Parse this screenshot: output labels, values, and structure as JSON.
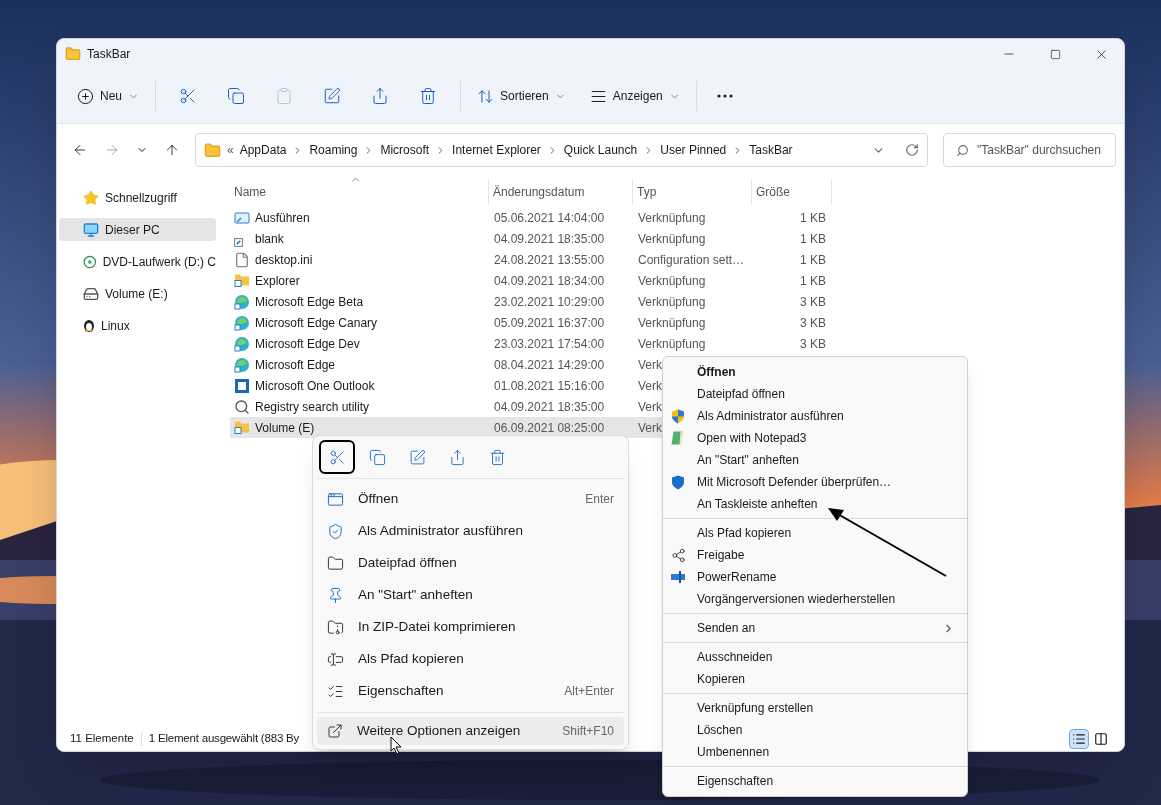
{
  "window": {
    "title": "TaskBar"
  },
  "toolbar": {
    "new_label": "Neu",
    "sort_label": "Sortieren",
    "view_label": "Anzeigen",
    "actions": [
      {
        "kind": "cut",
        "disabled": false
      },
      {
        "kind": "copy",
        "disabled": false
      },
      {
        "kind": "paste",
        "disabled": true
      },
      {
        "kind": "rename",
        "disabled": false
      },
      {
        "kind": "share",
        "disabled": false
      },
      {
        "kind": "delete",
        "disabled": false
      }
    ]
  },
  "address": {
    "prefix": "«",
    "crumbs": [
      "AppData",
      "Roaming",
      "Microsoft",
      "Internet Explorer",
      "Quick Launch",
      "User Pinned",
      "TaskBar"
    ],
    "search_placeholder": "\"TaskBar\" durchsuchen"
  },
  "sidebar": {
    "items": [
      {
        "label": "Schnellzugriff",
        "kind": "star",
        "selected": false
      },
      {
        "label": "Dieser PC",
        "kind": "pc",
        "selected": true
      },
      {
        "label": "DVD-Laufwerk (D:) C",
        "kind": "dvd",
        "selected": false
      },
      {
        "label": "Volume (E:)",
        "kind": "drive",
        "selected": false
      },
      {
        "label": "Linux",
        "kind": "linux",
        "selected": false
      }
    ]
  },
  "table": {
    "columns": [
      "Name",
      "Änderungsdatum",
      "Typ",
      "Größe"
    ],
    "rows": [
      {
        "name": "Ausführen",
        "date": "05.06.2021 14:04:00",
        "type": "Verknüpfung",
        "size": "1 KB",
        "kind": "run",
        "selected": false
      },
      {
        "name": "blank",
        "date": "04.09.2021 18:35:00",
        "type": "Verknüpfung",
        "size": "1 KB",
        "kind": "blank",
        "selected": false
      },
      {
        "name": "desktop.ini",
        "date": "24.08.2021 13:55:00",
        "type": "Configuration sett…",
        "size": "1 KB",
        "kind": "ini",
        "selected": false
      },
      {
        "name": "Explorer",
        "date": "04.09.2021 18:34:00",
        "type": "Verknüpfung",
        "size": "1 KB",
        "kind": "folder",
        "selected": false
      },
      {
        "name": "Microsoft Edge Beta",
        "date": "23.02.2021 10:29:00",
        "type": "Verknüpfung",
        "size": "3 KB",
        "kind": "edge",
        "selected": false
      },
      {
        "name": "Microsoft Edge Canary",
        "date": "05.09.2021 16:37:00",
        "type": "Verknüpfung",
        "size": "3 KB",
        "kind": "edge",
        "selected": false
      },
      {
        "name": "Microsoft Edge Dev",
        "date": "23.03.2021 17:54:00",
        "type": "Verknüpfung",
        "size": "3 KB",
        "kind": "edge",
        "selected": false
      },
      {
        "name": "Microsoft Edge",
        "date": "08.04.2021 14:29:00",
        "type": "Verk",
        "kind": "edge",
        "selected": false
      },
      {
        "name": "Microsoft One Outlook",
        "date": "01.08.2021 15:16:00",
        "type": "Verk",
        "kind": "outlook",
        "selected": false
      },
      {
        "name": "Registry search utility",
        "date": "04.09.2021 18:35:00",
        "type": "Verk",
        "kind": "search",
        "selected": false
      },
      {
        "name": "Volume (E)",
        "date": "06.09.2021 08:25:00",
        "type": "Verk",
        "kind": "folder",
        "selected": true
      }
    ]
  },
  "status_bar": {
    "count": "11 Elemente",
    "selection": "1 Element ausgewählt (883 By",
    "views": [
      {
        "kind": "details",
        "selected": true
      },
      {
        "kind": "tiles",
        "selected": false
      }
    ]
  },
  "context_menu": {
    "quick_actions": [
      {
        "kind": "cut",
        "selected": true
      },
      {
        "kind": "copy",
        "selected": false
      },
      {
        "kind": "rename",
        "selected": false
      },
      {
        "kind": "share",
        "selected": false
      },
      {
        "kind": "delete",
        "selected": false
      }
    ],
    "items": [
      {
        "label": "Öffnen",
        "shortcut": "Enter",
        "kind": "open"
      },
      {
        "label": "Als Administrator ausführen",
        "kind": "admin"
      },
      {
        "label": "Dateipfad öffnen",
        "kind": "folder"
      },
      {
        "label": "An \"Start\" anheften",
        "kind": "pin"
      },
      {
        "label": "In ZIP-Datei komprimieren",
        "kind": "zip"
      },
      {
        "label": "Als Pfad kopieren",
        "kind": "path"
      },
      {
        "label": "Eigenschaften",
        "shortcut": "Alt+Enter",
        "kind": "props"
      }
    ],
    "more": {
      "label": "Weitere Optionen anzeigen",
      "shortcut": "Shift+F10",
      "selected": true
    }
  },
  "classic_menu": {
    "groups": [
      [
        {
          "label": "Öffnen",
          "kind": "default"
        },
        {
          "label": "Dateipfad öffnen",
          "kind": "plain"
        },
        {
          "label": "Als Administrator ausführen",
          "kind": "uac"
        },
        {
          "label": "Open with Notepad3",
          "kind": "notepad"
        },
        {
          "label": "An \"Start\" anheften",
          "kind": "plain"
        },
        {
          "label": "Mit Microsoft Defender überprüfen…",
          "kind": "defender"
        },
        {
          "label": "An Taskleiste anheften",
          "kind": "plain"
        }
      ],
      [
        {
          "label": "Als Pfad kopieren",
          "kind": "plain"
        },
        {
          "label": "Freigabe",
          "kind": "share"
        },
        {
          "label": "PowerRename",
          "kind": "powerrename"
        },
        {
          "label": "Vorgängerversionen wiederherstellen",
          "kind": "plain"
        }
      ],
      [
        {
          "label": "Senden an",
          "kind": "submenu"
        }
      ],
      [
        {
          "label": "Ausschneiden",
          "kind": "plain"
        },
        {
          "label": "Kopieren",
          "kind": "plain"
        }
      ],
      [
        {
          "label": "Verknüpfung erstellen",
          "kind": "plain"
        },
        {
          "label": "Löschen",
          "kind": "plain"
        },
        {
          "label": "Umbenennen",
          "kind": "plain"
        }
      ],
      [
        {
          "label": "Eigenschaften",
          "kind": "plain"
        }
      ]
    ]
  }
}
